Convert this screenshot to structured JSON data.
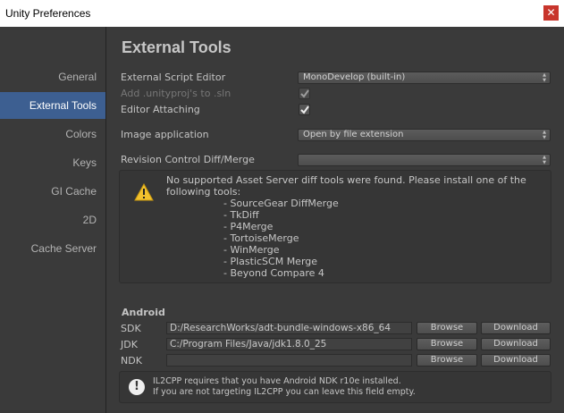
{
  "window": {
    "title": "Unity Preferences",
    "close_glyph": "✕"
  },
  "sidebar": {
    "items": [
      {
        "label": "General",
        "active": false
      },
      {
        "label": "External Tools",
        "active": true
      },
      {
        "label": "Colors",
        "active": false
      },
      {
        "label": "Keys",
        "active": false
      },
      {
        "label": "GI Cache",
        "active": false
      },
      {
        "label": "2D",
        "active": false
      },
      {
        "label": "Cache Server",
        "active": false
      }
    ]
  },
  "main": {
    "heading": "External Tools",
    "fields": {
      "script_editor": {
        "label": "External Script Editor",
        "value": "MonoDevelop (built-in)"
      },
      "add_unityproj": {
        "label": "Add .unityproj's to .sln",
        "checked": true,
        "disabled": true
      },
      "editor_attaching": {
        "label": "Editor Attaching",
        "checked": true
      },
      "image_application": {
        "label": "Image application",
        "value": "Open by file extension"
      },
      "revision_control": {
        "label": "Revision Control Diff/Merge",
        "value": ""
      }
    },
    "warning": {
      "icon": "warning-icon",
      "line1": "No supported Asset Server diff tools were found. Please install one of the",
      "line2": "following tools:",
      "tools": [
        "- SourceGear DiffMerge",
        "- TkDiff",
        "- P4Merge",
        "- TortoiseMerge",
        "- WinMerge",
        "- PlasticSCM Merge",
        "- Beyond Compare 4"
      ]
    },
    "android": {
      "title": "Android",
      "browse_label": "Browse",
      "download_label": "Download",
      "sdk": {
        "label": "SDK",
        "value": "D:/ResearchWorks/adt-bundle-windows-x86_64"
      },
      "jdk": {
        "label": "JDK",
        "value": "C:/Program Files/Java/jdk1.8.0_25"
      },
      "ndk": {
        "label": "NDK",
        "value": ""
      }
    },
    "info": {
      "icon": "info-icon",
      "line1": "IL2CPP requires that you have Android NDK r10e installed.",
      "line2": "If you are not targeting IL2CPP you can leave this field empty."
    }
  },
  "colors": {
    "accent": "#3d5f91",
    "background": "#3a3a3a",
    "close_button": "#c8352c"
  }
}
